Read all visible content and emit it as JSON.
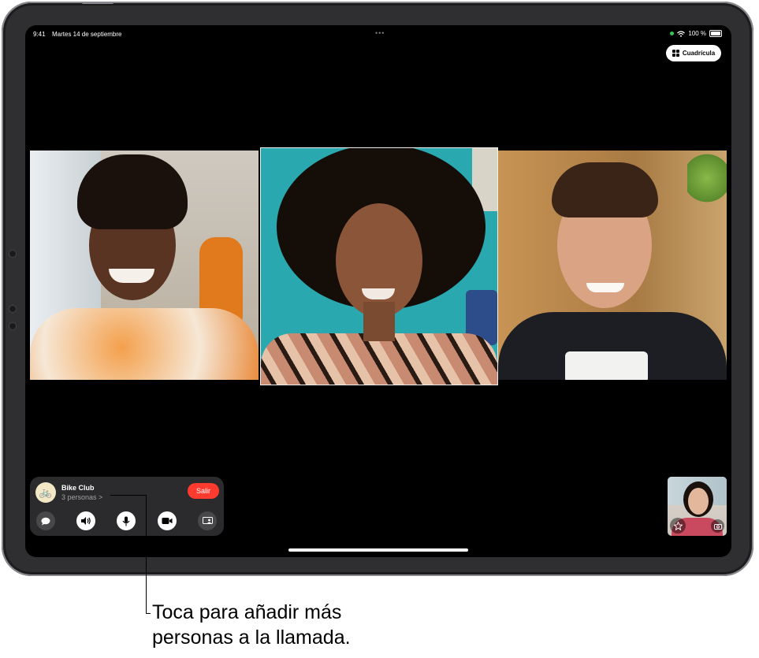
{
  "status_bar": {
    "time": "9:41",
    "date": "Martes 14 de septiembre",
    "battery": "100 %"
  },
  "view_toggle": {
    "label": "Cuadrícula",
    "icon": "grid-icon"
  },
  "participants": [
    {
      "name": "participant-1"
    },
    {
      "name": "participant-2"
    },
    {
      "name": "participant-3"
    }
  ],
  "call_panel": {
    "group_name": "Bike Club",
    "people_count": "3 personas",
    "people_chevron": ">",
    "leave_label": "Salir",
    "controls": [
      "message-icon",
      "speaker-icon",
      "microphone-icon",
      "camera-icon",
      "shareplay-icon"
    ]
  },
  "self_view": {
    "effects_icon": "effects-icon",
    "flip_icon": "flip-camera-icon"
  },
  "callout": {
    "line1": "Toca para añadir más",
    "line2": "personas a la llamada."
  }
}
